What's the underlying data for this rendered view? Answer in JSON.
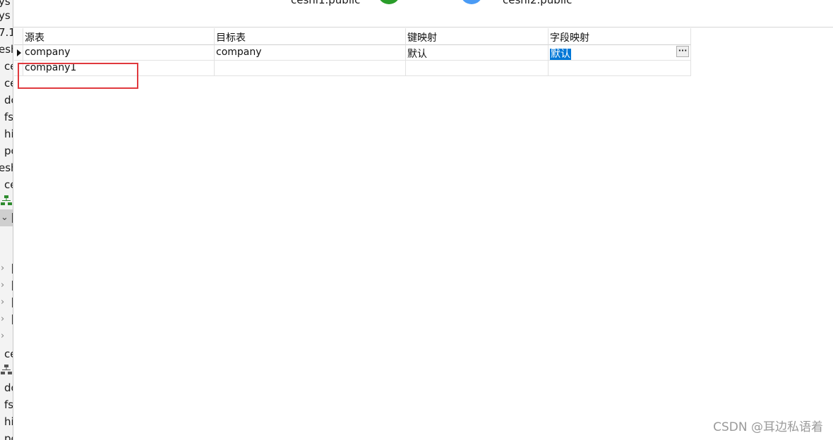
{
  "left_tree": {
    "items": [
      "ys",
      "ys",
      "7.1",
      "esh",
      "ce",
      "ce",
      "do",
      "fs",
      "hi",
      "po",
      "esh",
      "ce",
      "ce",
      "do",
      "fs",
      "hi",
      "pc"
    ]
  },
  "top_header": {
    "source_label": "ceshi1.public",
    "target_label": "ceshi2.public",
    "source_color": "#2a9d2a",
    "target_color": "#4a9bf5"
  },
  "grid": {
    "columns": [
      "源表",
      "目标表",
      "键映射",
      "字段映射"
    ],
    "rows": [
      {
        "source": "company",
        "target": "company",
        "key_mapping": "默认",
        "field_mapping": "默认",
        "current": true
      },
      {
        "source": "company1",
        "target": "",
        "key_mapping": "",
        "field_mapping": "",
        "current": false
      }
    ],
    "ellipsis": "···"
  },
  "highlight_color": "#e0393e",
  "selection_color": "#0078d7",
  "watermark": "CSDN @耳边私语着"
}
